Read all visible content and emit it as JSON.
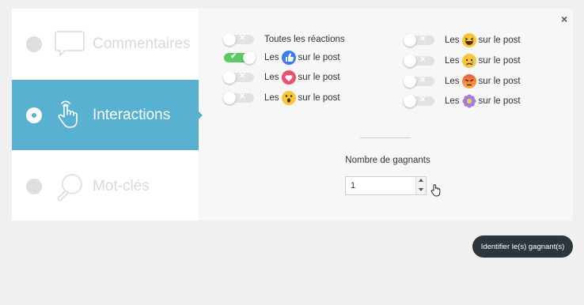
{
  "close_label": "×",
  "methods": [
    {
      "label": "Commentaires",
      "icon": "speech-bubble-icon",
      "selected": false
    },
    {
      "label": "Interactions",
      "icon": "pointing-hand-icon",
      "selected": true
    },
    {
      "label": "Mot-clés",
      "icon": "magnifier-icon",
      "selected": false
    }
  ],
  "reactions_left": [
    {
      "prefix": "Toutes les réactions",
      "suffix": "",
      "emoji": "",
      "on": false
    },
    {
      "prefix": "Les",
      "suffix": "sur le post",
      "emoji": "like-icon",
      "on": true
    },
    {
      "prefix": "Les",
      "suffix": "sur le post",
      "emoji": "love-icon",
      "on": false
    },
    {
      "prefix": "Les",
      "suffix": "sur le post",
      "emoji": "wow-icon",
      "on": false
    }
  ],
  "reactions_right": [
    {
      "prefix": "Les",
      "suffix": "sur le post",
      "emoji": "haha-icon",
      "on": false
    },
    {
      "prefix": "Les",
      "suffix": "sur le post",
      "emoji": "sad-icon",
      "on": false
    },
    {
      "prefix": "Les",
      "suffix": "sur le post",
      "emoji": "angry-icon",
      "on": false
    },
    {
      "prefix": "Les",
      "suffix": "sur le post",
      "emoji": "flower-icon",
      "on": false
    }
  ],
  "winners": {
    "label": "Nombre de gagnants",
    "value": "1"
  },
  "submit_label": "Identifier le(s) gagnant(s)",
  "colors": {
    "accent": "#58b1d1",
    "toggle_on": "#5ccb5f",
    "button": "#2a363b"
  }
}
